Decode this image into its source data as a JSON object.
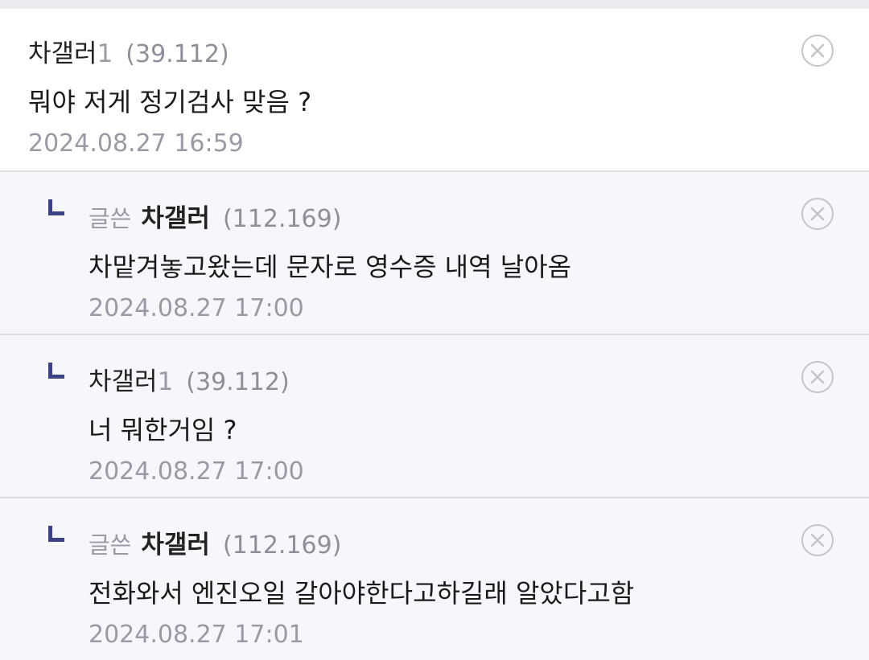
{
  "comments": [
    {
      "nickname": "차갤러",
      "nick_suffix": "1",
      "ip": "(39.112)",
      "body": "뭐야 저게 정기검사 맞음 ?",
      "date": "2024.08.27 16:59"
    },
    {
      "badge": "글쓴",
      "nickname": "차갤러",
      "ip": "(112.169)",
      "body": "차맡겨놓고왔는데 문자로 영수증 내역 날아옴",
      "date": "2024.08.27 17:00"
    },
    {
      "nickname": "차갤러",
      "nick_suffix": "1",
      "ip": "(39.112)",
      "body": "너 뭐한거임 ?",
      "date": "2024.08.27 17:00"
    },
    {
      "badge": "글쓴",
      "nickname": "차갤러",
      "ip": "(112.169)",
      "body": "전화와서 엔진오일 갈아야한다고하길래 알았다고함",
      "date": "2024.08.27 17:01"
    }
  ],
  "icons": {
    "delete": "close-circle-icon",
    "reply": "reply-arrow-icon"
  },
  "colors": {
    "reply_mark": "#3b4386",
    "reply_bg": "#f6f7fb",
    "main_bg": "#ffffff"
  }
}
